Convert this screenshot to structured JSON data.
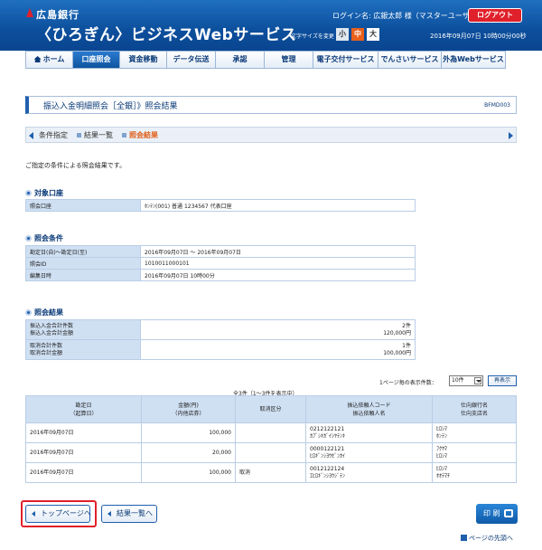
{
  "header": {
    "brand_top": "広島銀行",
    "brand_main": "〈ひろぎん〉ビジネスWebサービス",
    "login_line": "ログイン名: 広銀太郎 様（マスターユーザ）",
    "logout": "ログアウト",
    "fontsize_label": "文字サイズを変更",
    "fontsize_small": "小",
    "fontsize_mid": "中",
    "fontsize_large": "大",
    "datetime": "2016年09月07日 10時00分00秒"
  },
  "nav": {
    "items": [
      {
        "label": "ホーム"
      },
      {
        "label": "口座照会"
      },
      {
        "label": "資金移動"
      },
      {
        "label": "データ伝送"
      },
      {
        "label": "承認"
      },
      {
        "label": "管理"
      },
      {
        "label": "電子交付サービス"
      },
      {
        "label": "でんさいサービス"
      },
      {
        "label": "外為Webサービス"
      }
    ]
  },
  "page": {
    "title": "振込入金明細照会［全銀］》照会結果",
    "screen_id": "BFMD003"
  },
  "steps": {
    "items": [
      "条件指定",
      "結果一覧",
      "照会結果"
    ]
  },
  "intro": "ご指定の条件による照会結果です。",
  "account": {
    "heading": "対象口座",
    "label": "照会口座",
    "value": "ﾎﾝﾃﾝ(001) 普通 1234567 代表口座"
  },
  "conditions": {
    "heading": "照会条件",
    "rows": [
      {
        "label": "勘定日(自)～勘定日(至)",
        "value": "2016年09月07日 ～ 2016年09月07日"
      },
      {
        "label": "照会ID",
        "value": "1010011000101"
      },
      {
        "label": "編集日時",
        "value": "2016年09月07日 10時00分"
      }
    ]
  },
  "summary": {
    "heading": "照会結果",
    "rows": [
      {
        "label1": "振込入金合計件数",
        "label2": "振込入金合計金額",
        "value1": "2件",
        "value2": "120,000円"
      },
      {
        "label1": "取消合計件数",
        "label2": "取消合計金額",
        "value1": "1件",
        "value2": "100,000円"
      }
    ]
  },
  "results": {
    "per_page_label": "1ページ毎の表示件数：",
    "per_page_value": "10件",
    "redisplay": "再表示",
    "count_caption": "全3件（1～3件を表示中）",
    "headers": [
      {
        "l1": "勘定日",
        "l2": "（起算日）"
      },
      {
        "l1": "金額(円)",
        "l2": "（内他店券）"
      },
      {
        "l1": "取消区分",
        "l2": ""
      },
      {
        "l1": "振込依頼人コード",
        "l2": "振込依頼人名"
      },
      {
        "l1": "仕向銀行名",
        "l2": "仕向支店名"
      }
    ],
    "rows": [
      {
        "date": "2016年09月07日",
        "amount": "100,000",
        "cancel": "",
        "code": "0212122121",
        "name": "ｶﾌﾞｼｷｶﾞｲｼﾔﾃﾝｷ",
        "bank": "ﾋﾛｼﾏ",
        "branch": "ﾎﾝﾃﾝ"
      },
      {
        "date": "2016年09月07日",
        "amount": "20,000",
        "cancel": "",
        "code": "0000122121",
        "name": "ﾋﾛｷﾞﾝｼﾖｳｾﾞﾝｶｲ",
        "bank": "ﾌｸﾔﾏ",
        "branch": "ﾋﾛｼﾏ"
      },
      {
        "date": "2016年09月07日",
        "amount": "100,000",
        "cancel": "取消",
        "code": "0012122124",
        "name": "ｴﾋﾛｷﾞﾝｼﾖｳｼﾞﾃﾝ",
        "bank": "ﾋﾛｼﾏ",
        "branch": "ｵｵﾃﾏﾁ"
      }
    ]
  },
  "buttons": {
    "top": "トップページへ",
    "list": "結果一覧へ",
    "print": "印 刷",
    "pagetop": "ページの先頭へ"
  },
  "colors": {
    "header_blue": "#0c4f9c",
    "accent_orange": "#e8601c",
    "logout_red": "#e0202a",
    "highlight_red": "#e2202a"
  }
}
